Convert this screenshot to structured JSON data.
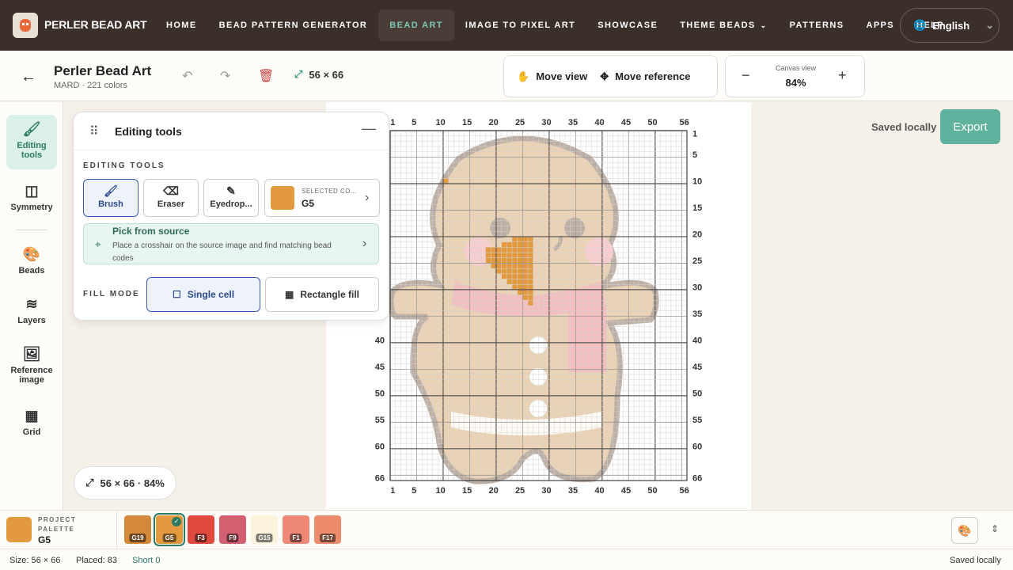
{
  "nav": {
    "brand": "PERLER BEAD ART",
    "links": [
      "HOME",
      "BEAD PATTERN GENERATOR",
      "BEAD ART",
      "IMAGE TO PIXEL ART",
      "SHOWCASE",
      "THEME BEADS",
      "PATTERNS",
      "APPS",
      "HELP"
    ],
    "active_index": 2,
    "language": "English"
  },
  "toolbar": {
    "title": "Perler Bead Art",
    "subtitle": "MARD · 221 colors",
    "size": "56 × 66",
    "move_view": "Move view",
    "move_reference": "Move reference",
    "canvas_view_label": "Canvas view",
    "zoom": "84%",
    "saved": "Saved locally",
    "export": "Export"
  },
  "sidebar": {
    "items": [
      {
        "label": "Editing tools",
        "icon": "brush-icon"
      },
      {
        "label": "Symmetry",
        "icon": "symmetry-icon"
      },
      {
        "label": "Beads",
        "icon": "palette-icon"
      },
      {
        "label": "Layers",
        "icon": "layers-icon"
      },
      {
        "label": "Reference image",
        "icon": "image-icon"
      },
      {
        "label": "Grid",
        "icon": "grid-icon"
      }
    ]
  },
  "panel": {
    "title": "Editing tools",
    "section_label": "EDITING TOOLS",
    "tools": [
      "Brush",
      "Eraser",
      "Eyedrop..."
    ],
    "selected_color_label": "SELECTED CO...",
    "selected_color_value": "G5",
    "pick_title": "Pick from source",
    "pick_desc": "Place a crosshair on the source image and find matching bead codes",
    "fill_label": "FILL MODE",
    "fill_single": "Single cell",
    "fill_rect": "Rectangle fill"
  },
  "canvas": {
    "x_ticks": [
      "1",
      "5",
      "10",
      "15",
      "20",
      "25",
      "30",
      "35",
      "40",
      "45",
      "50",
      "56"
    ],
    "y_ticks": [
      "1",
      "5",
      "10",
      "15",
      "20",
      "25",
      "30",
      "35",
      "40",
      "45",
      "50",
      "55",
      "60",
      "66"
    ],
    "chip": "56 × 66 · 84%"
  },
  "palette": {
    "label": "PROJECT PALETTE",
    "selected": "G5",
    "beads": [
      {
        "code": "G19",
        "color": "#d4883a"
      },
      {
        "code": "G5",
        "color": "#e39a3e"
      },
      {
        "code": "F3",
        "color": "#e04a3e"
      },
      {
        "code": "F9",
        "color": "#d26070"
      },
      {
        "code": "G15",
        "color": "#fcf3dc"
      },
      {
        "code": "F1",
        "color": "#f08878"
      },
      {
        "code": "F17",
        "color": "#ec8c6c"
      }
    ]
  },
  "status": {
    "size": "Size: 56 × 66",
    "placed": "Placed: 83",
    "short": "Short 0",
    "saved": "Saved locally"
  }
}
